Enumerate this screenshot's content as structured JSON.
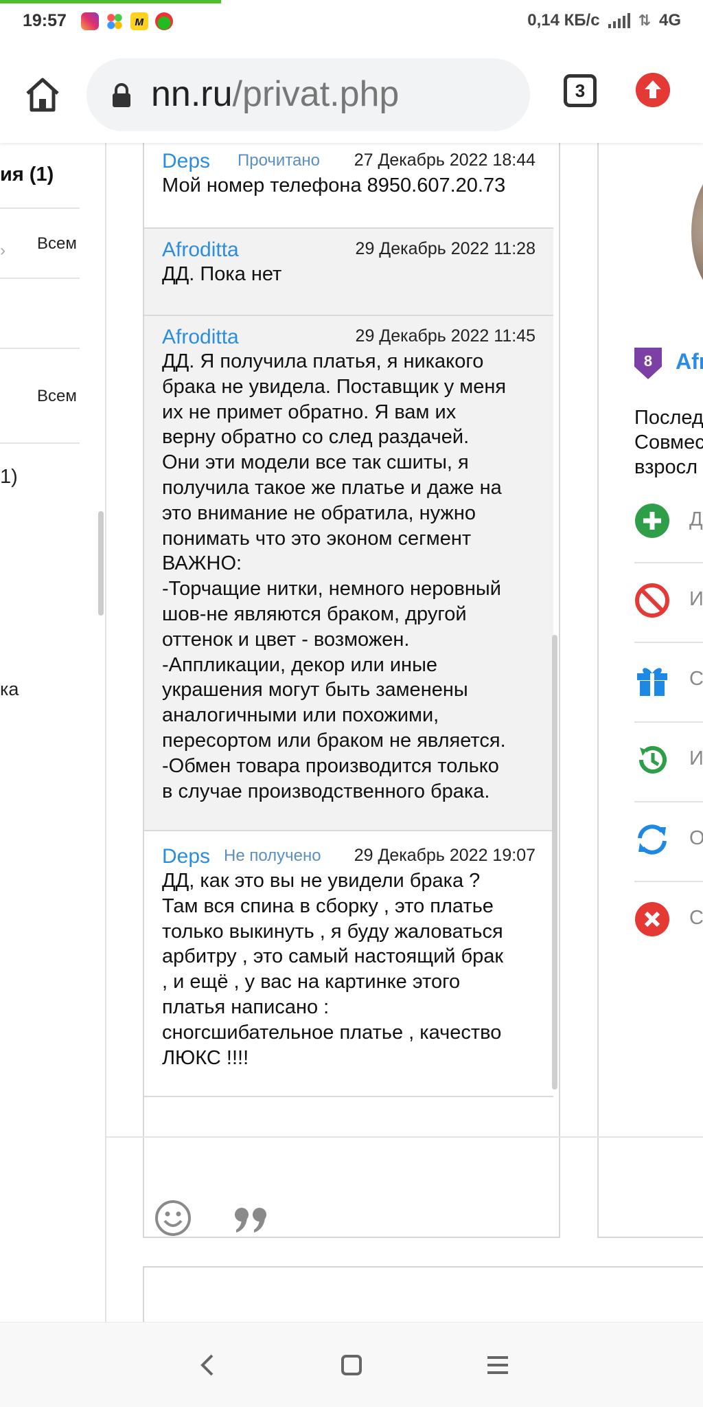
{
  "status_bar": {
    "time": "19:57",
    "icons": [
      "instagram-icon",
      "dots-app-icon",
      "market-icon",
      "ball-app-icon"
    ],
    "market_glyph": "м",
    "speed": "0,14 КБ/с",
    "network": "4G"
  },
  "browser": {
    "url_domain": "nn.ru",
    "url_path": "/privat.php",
    "tab_count": "3"
  },
  "left_column": {
    "heading": "ия (1)",
    "row1_label": "Всем",
    "row2_label": "Всем",
    "fragment1": "1)",
    "fragment2": "ка"
  },
  "messages": [
    {
      "author": "Deps",
      "state": "Прочитано",
      "time": "27 Декабрь 2022 18:44",
      "text": "Мой номер телефона 8950.607.20.73"
    },
    {
      "author": "Afroditta",
      "state": "",
      "time": "29 Декабрь 2022 11:28",
      "text": "ДД. Пока нет"
    },
    {
      "author": "Afroditta",
      "state": "",
      "time": "29 Декабрь 2022 11:45",
      "text": "ДД. Я получила платья, я никакого\nбрака не увидела. Поставщик у меня\nих не примет обратно. Я вам их\nверну обратно со след раздачей.\nОни эти модели все так сшиты, я\nполучила такое же платье и даже на\nэто внимание не обратила, нужно\nпонимать что это эконом сегмент\nВАЖНО:\n-Торчащие нитки, немного неровный\nшов-не являются браком, другой\nоттенок и цвет - возможен.\n-Аппликации, декор или иные\nукрашения могут быть заменены\nаналогичными или похожими,\nпересортом или браком не является.\n-Обмен товара производится только\nв случае производственного брака."
    },
    {
      "author": "Deps",
      "state": "Не получено",
      "time": "29 Декабрь 2022 19:07",
      "text": "ДД, как это вы не увидели брака ?\nТам вся спина в сборку , это платье\nтолько выкинуть , я буду жаловаться\nарбитру , это самый настоящий брак\n, и ещё , у вас на картинке этого\nплатья написано :\nсногсшибательное платье , качество\nЛЮКС !!!!"
    }
  ],
  "profile": {
    "level": "8",
    "name": "Afr",
    "line1": "Послед",
    "line2": "Совмес",
    "line3": "взросл",
    "actions": [
      {
        "label": "Д",
        "icon": "plus-circle-icon",
        "color": "#2e9e48"
      },
      {
        "label": "И",
        "icon": "ban-icon",
        "color": "#e53935"
      },
      {
        "label": "С",
        "icon": "gift-icon",
        "color": "#1e88e5"
      },
      {
        "label": "И",
        "icon": "history-icon",
        "color": "#2e9e48"
      },
      {
        "label": "О",
        "icon": "refresh-icon",
        "color": "#1e88e5"
      },
      {
        "label": "С",
        "icon": "close-circle-icon",
        "color": "#e53935"
      }
    ]
  },
  "composer": {
    "icons": [
      "smile-icon",
      "quote-icon"
    ]
  }
}
